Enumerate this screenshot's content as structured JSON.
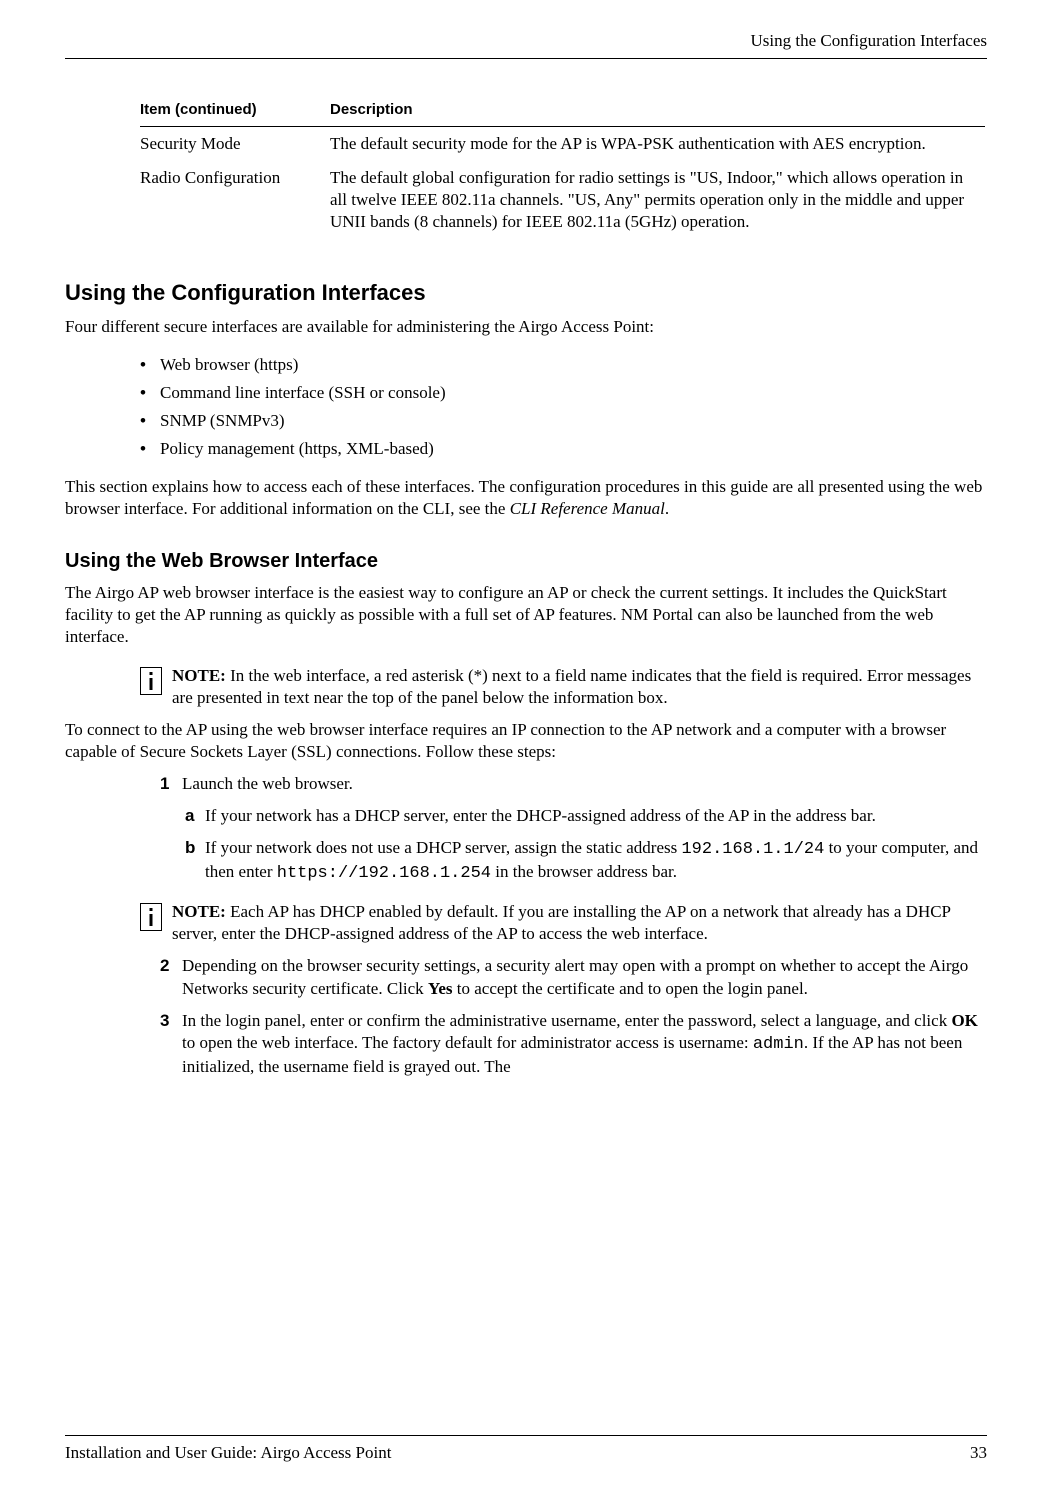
{
  "header_title": "Using the Configuration Interfaces",
  "table": {
    "head_item": "Item  (continued)",
    "head_desc": "Description",
    "rows": [
      {
        "item": "Security Mode",
        "desc": " The default security mode for the AP is WPA-PSK authentication with AES encryption."
      },
      {
        "item": "Radio Configuration",
        "desc": "The default global configuration for radio settings is \"US, Indoor,\" which allows operation in all twelve IEEE 802.11a channels. \"US, Any\" permits operation only in the middle and upper UNII bands (8 channels) for IEEE 802.11a (5GHz) operation."
      }
    ]
  },
  "h2": "Using the Configuration Interfaces",
  "p1": "Four different secure interfaces are available for administering the Airgo Access Point:",
  "bullets": [
    "Web browser (https)",
    "Command line interface (SSH or console)",
    "SNMP (SNMPv3)",
    "Policy management (https, XML-based)"
  ],
  "p2_a": "This section explains how to access each of these interfaces. The configuration procedures in this guide are all presented using the web browser interface. For additional information on the CLI, see the ",
  "p2_b": "CLI Reference Manual",
  "p2_c": ".",
  "h3": "Using the Web Browser Interface",
  "p3": "The Airgo AP web browser interface is the easiest way to configure an AP or check the current settings. It includes the QuickStart facility to get the AP running as quickly as possible with a full set of AP features. NM Portal can also be launched from the web interface.",
  "note1_label": "NOTE:",
  "note1_text": " In the web interface, a red asterisk (*) next to a field name indicates that the field is required. Error messages are presented in text near the top of the panel below the information box.",
  "p4": "To connect to the AP using the web browser interface requires an IP connection to the AP network and a computer with a browser capable of Secure Sockets Layer (SSL) connections. Follow these steps:",
  "step1_num": "1",
  "step1_text": "Launch the web browser.",
  "sub_a_num": "a",
  "sub_a_text": "If your network has a DHCP server, enter the DHCP-assigned address of the AP in the address bar.",
  "sub_b_num": "b",
  "sub_b_a": "If your network does not use a DHCP server, assign the static address ",
  "sub_b_code1": "192.168.1.1/24",
  "sub_b_b": " to your computer, and then enter ",
  "sub_b_code2": "https://192.168.1.254",
  "sub_b_c": " in the browser address bar.",
  "note2_label": "NOTE:",
  "note2_text": " Each AP has DHCP enabled by default. If you are installing the AP on a network that already has a DHCP server, enter the DHCP-assigned address of the AP to access the web interface.",
  "step2_num": "2",
  "step2_a": "Depending on the browser security settings, a security alert may open with a prompt on whether to accept the Airgo Networks security certificate. Click ",
  "step2_bold": "Yes",
  "step2_b": " to accept the certificate and to open the login panel.",
  "step3_num": "3",
  "step3_a": "In the login panel, enter or confirm the administrative username, enter the password, select a language, and click ",
  "step3_bold": "OK",
  "step3_b": " to open the web interface. The factory default for administrator access is username: ",
  "step3_code": "admin",
  "step3_c": ". If the AP has not been initialized, the username field is grayed out. The",
  "footer_left": "Installation and User Guide: Airgo Access Point",
  "footer_right": "33"
}
